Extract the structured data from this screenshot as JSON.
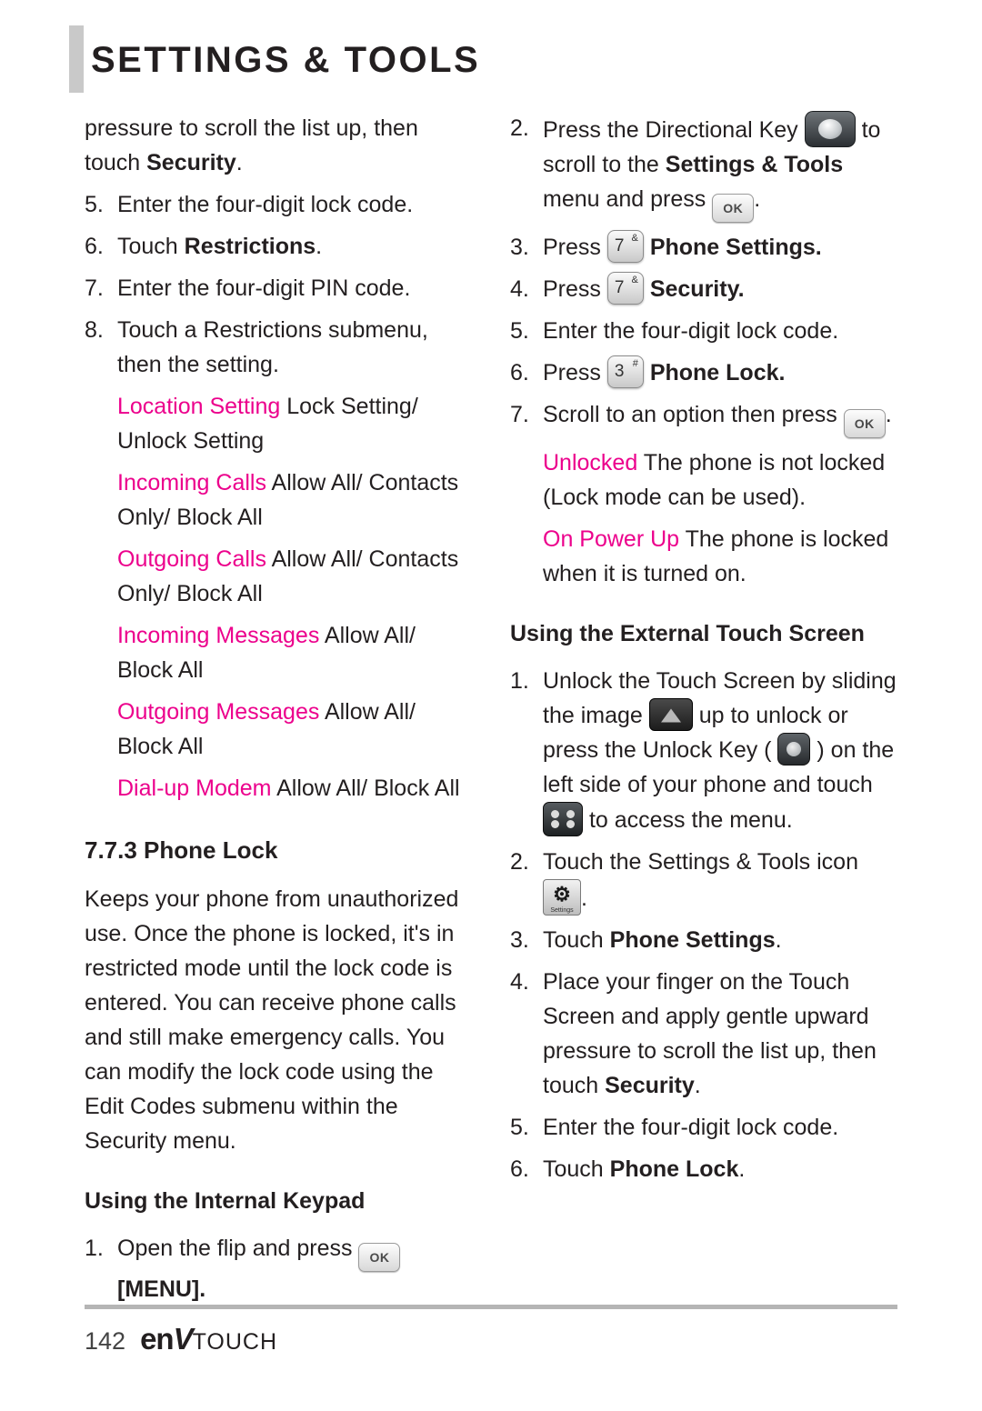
{
  "header": {
    "title": "SETTINGS & TOOLS"
  },
  "left_column": {
    "cont_para": "pressure to scroll the list up, then touch ",
    "cont_para_bold": "Security",
    "cont_para_end": ".",
    "steps": [
      {
        "num": "5.",
        "text": "Enter the four-digit lock code."
      },
      {
        "num": "6.",
        "pre": "Touch ",
        "bold": "Restrictions",
        "post": "."
      },
      {
        "num": "7.",
        "text": "Enter the four-digit PIN code."
      },
      {
        "num": "8.",
        "text": "Touch a Restrictions submenu, then the setting."
      }
    ],
    "options": [
      {
        "label": "Location Setting",
        "values": "Lock Setting/ Unlock Setting"
      },
      {
        "label": "Incoming Calls",
        "values": "Allow All/ Contacts Only/ Block All"
      },
      {
        "label": "Outgoing Calls",
        "values": "Allow All/ Contacts Only/ Block All"
      },
      {
        "label": "Incoming Messages",
        "values": "Allow All/ Block All"
      },
      {
        "label": "Outgoing Messages",
        "values": "Allow All/ Block All"
      },
      {
        "label": "Dial-up Modem",
        "values": "Allow All/ Block All"
      }
    ],
    "section_heading": "7.7.3 Phone Lock",
    "body_text": "Keeps your phone from unauthorized use. Once the phone is locked, it's in restricted mode until the lock code is entered. You can receive phone calls and still make emergency calls. You can modify the lock code using the Edit Codes submenu within the Security menu.",
    "sub_heading": "Using the Internal Keypad",
    "keypad_step_num": "1.",
    "keypad_step_pre": "Open the flip and press",
    "keypad_step_post": "[MENU]",
    "keypad_step_end": "."
  },
  "right_column": {
    "steps": [
      {
        "num": "2.",
        "pre": "Press the Directional Key",
        "mid": "to scroll to the ",
        "bold": "Settings & Tools",
        "post": " menu and press",
        "end": "."
      },
      {
        "num": "3.",
        "pre": "Press",
        "bold": "Phone Settings",
        "end": "."
      },
      {
        "num": "4.",
        "pre": "Press",
        "bold": "Security",
        "end": "."
      },
      {
        "num": "5.",
        "text": "Enter the four-digit lock code."
      },
      {
        "num": "6.",
        "pre": "Press",
        "bold": "Phone Lock",
        "end": "."
      },
      {
        "num": "7.",
        "pre": "Scroll to an option then press",
        "end": "."
      }
    ],
    "options": [
      {
        "label": "Unlocked",
        "values": "The phone is not locked (Lock mode can be used)."
      },
      {
        "label": "On Power Up",
        "values": "The phone is locked when it is turned on."
      }
    ],
    "sub_heading": "Using the External Touch Screen",
    "ext_steps": [
      {
        "num": "1.",
        "p1": "Unlock the Touch Screen by sliding the image",
        "p2": "up to unlock or press the Unlock Key (",
        "p3": ") on the left side of your phone and touch",
        "p4": "to access the menu."
      },
      {
        "num": "2.",
        "pre": "Touch the Settings & Tools icon",
        "end": "."
      },
      {
        "num": "3.",
        "pre": "Touch ",
        "bold": "Phone Settings",
        "end": "."
      },
      {
        "num": "4.",
        "pre": "Place your finger on the Touch Screen and apply gentle upward pressure to scroll the list up, then touch ",
        "bold": "Security",
        "end": "."
      },
      {
        "num": "5.",
        "text": "Enter the four-digit lock code."
      },
      {
        "num": "6.",
        "pre": "Touch ",
        "bold": "Phone Lock",
        "end": "."
      }
    ]
  },
  "keys": {
    "ok": "OK",
    "seven": "7",
    "seven_sup": "&",
    "three": "3",
    "three_sup": "#",
    "settings_tools_caption": "Settings\n& Tools"
  },
  "footer": {
    "page_number": "142",
    "logo_en": "en",
    "logo_v": "V",
    "logo_touch": "TOUCH"
  },
  "colors": {
    "accent": "#ec008c",
    "text": "#231f20",
    "rule": "#b5b5b5"
  }
}
